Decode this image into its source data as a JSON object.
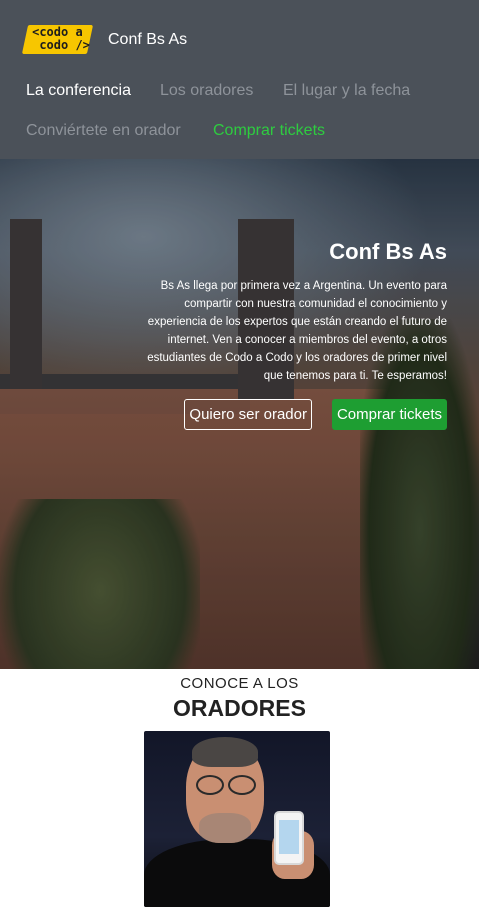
{
  "navbar": {
    "logo_text": "<codo a\n codo />",
    "brand": "Conf Bs As",
    "links": [
      {
        "label": "La conferencia"
      },
      {
        "label": "Los oradores"
      },
      {
        "label": "El lugar y la fecha"
      },
      {
        "label": "Conviértete en orador"
      },
      {
        "label": "Comprar tickets"
      }
    ],
    "colors": {
      "background": "#4b5159",
      "active": "#ffffff",
      "inactive": "#8e939a",
      "tickets": "#2ecc40"
    }
  },
  "hero": {
    "title": "Conf Bs As",
    "description": "Bs As llega por primera vez a Argentina. Un evento para compartir con nuestra comunidad el conocimiento y experiencia de los expertos que están creando el futuro de internet. Ven a conocer a miembros del evento, a otros estudiantes de Codo a Codo y los oradores de primer nivel que tenemos para ti. Te esperamos!",
    "buttons": {
      "speaker": "Quiero ser orador",
      "tickets": "Comprar tickets"
    },
    "colors": {
      "button_green": "#1e9e32"
    }
  },
  "speakers": {
    "kicker": "CONOCE A LOS",
    "title": "ORADORES"
  }
}
